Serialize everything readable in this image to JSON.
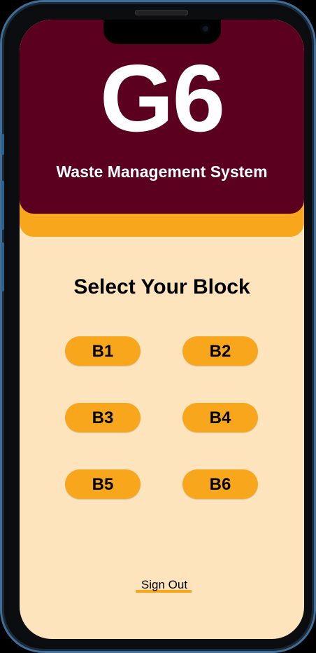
{
  "app": {
    "logo_text": "G6",
    "subtitle": "Waste Management System"
  },
  "main": {
    "title": "Select Your Block",
    "blocks": [
      {
        "label": "B1"
      },
      {
        "label": "B2"
      },
      {
        "label": "B3"
      },
      {
        "label": "B4"
      },
      {
        "label": "B5"
      },
      {
        "label": "B6"
      }
    ]
  },
  "footer": {
    "signout_label": "Sign Out"
  },
  "colors": {
    "header": "#5c0020",
    "accent": "#f8a61c",
    "background": "#fde4bc"
  }
}
